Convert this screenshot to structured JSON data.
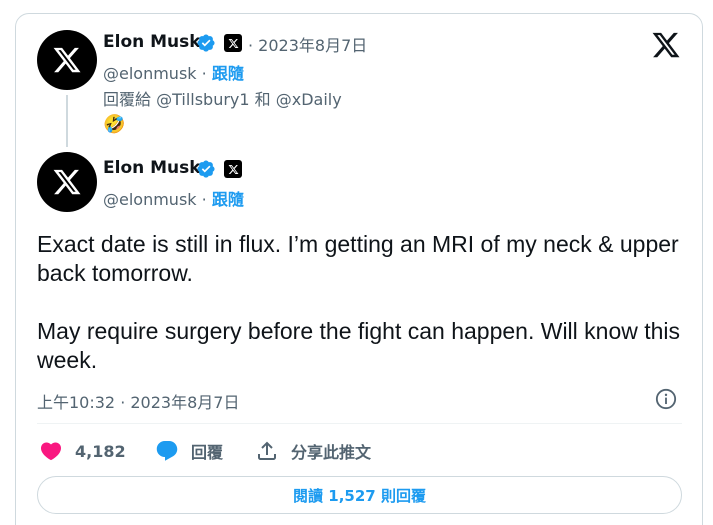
{
  "reply_context": {
    "author_name": "Elon Musk",
    "date": "· 2023年8月7日",
    "handle": "@elonmusk",
    "separator": "·",
    "follow_label": "跟隨",
    "replying_to": "回覆給 @Tillsbury1 和 @xDaily",
    "emoji": "🤣"
  },
  "tweet": {
    "author_name": "Elon Musk",
    "handle": "@elonmusk",
    "separator": "·",
    "follow_label": "跟隨",
    "text_paragraph_1": "Exact date is still in flux. I’m getting an MRI of my neck & upper back tomorrow.",
    "text_paragraph_2": "May require surgery before the fight can happen. Will know this week.",
    "timestamp": "上午10:32 · 2023年8月7日"
  },
  "actions": {
    "like_count": "4,182",
    "reply_label": "回覆",
    "share_label": "分享此推文"
  },
  "read_replies_label": "閱讀 1,527 則回覆",
  "colors": {
    "accent": "#1d9bf0",
    "like": "#f91880",
    "verified": "#1d9bf0",
    "text": "#0f1419",
    "secondary": "#536471"
  },
  "icons": [
    "x-logo-icon",
    "verified-badge-icon",
    "info-icon",
    "heart-icon",
    "reply-bubble-icon",
    "share-icon"
  ]
}
